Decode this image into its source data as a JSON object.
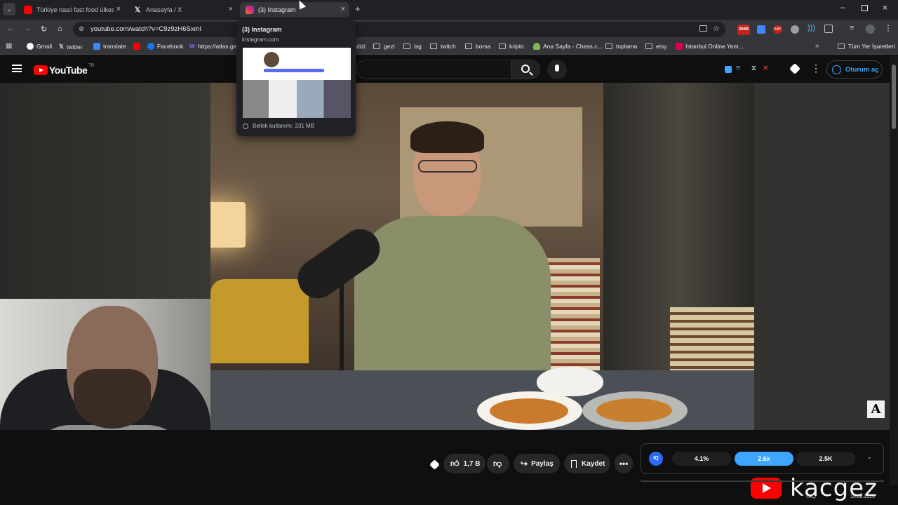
{
  "tabs": [
    {
      "title": "Türkiye nasıl fast food ülkesi ol",
      "favicon_color": "#ff0000"
    },
    {
      "title": "Anasayfa / X",
      "favicon_color": "#ffffff"
    },
    {
      "title": "(3) Instagram",
      "favicon_color": "#d6249f",
      "active": true
    }
  ],
  "toolbar": {
    "url": "youtube.com/watch?v=C9z9zH6SxmI",
    "badge": "259B"
  },
  "bookmarks": [
    {
      "label": "Gmail",
      "color": "#ea4335"
    },
    {
      "label": "twitter",
      "color": "#ffffff"
    },
    {
      "label": "translate",
      "color": "#4285f4"
    },
    {
      "label": "",
      "color": "#ff0000"
    },
    {
      "label": "Facebook",
      "color": "#1877f2"
    },
    {
      "label": "https://atlas.ge",
      "color": "#7b68ee"
    },
    {
      "label": "dizi",
      "folder": true
    },
    {
      "label": "gezi",
      "folder": true
    },
    {
      "label": "isg",
      "folder": true
    },
    {
      "label": "twitch",
      "folder": true
    },
    {
      "label": "borsa",
      "folder": true
    },
    {
      "label": "kripto",
      "folder": true
    },
    {
      "label": "Ana Sayfa - Chess.c...",
      "color": "#81b64c"
    },
    {
      "label": "toplama",
      "folder": true
    },
    {
      "label": "etsy",
      "folder": true
    },
    {
      "label": "İstanbul Online Yem...",
      "color": "#e0004d"
    },
    {
      "label": "Tüm Yer İşaretleri",
      "folder": true
    }
  ],
  "hovercard": {
    "title": "(3) Instagram",
    "domain": "instagram.com",
    "memory": "Bellek kullanımı: 231 MB"
  },
  "youtube": {
    "logo": "YouTube",
    "country": "TR",
    "signin": "Oturum aç"
  },
  "actions": {
    "likes": "1,7 B",
    "share": "Paylaş",
    "save": "Kaydet"
  },
  "extension": {
    "label": "IQ",
    "stat1": "4.1%",
    "stat2": "2.6x",
    "stat3": "2.5K"
  },
  "watermark": {
    "brand": "kacgez"
  },
  "taskbar": {
    "currency": "TRQ",
    "date": "15.08.2026"
  },
  "overlay_letter": "A",
  "colors": {
    "accent_blue": "#3ea6ff",
    "youtube_red": "#ff0000",
    "progress_blue": "#5b6cf2"
  }
}
